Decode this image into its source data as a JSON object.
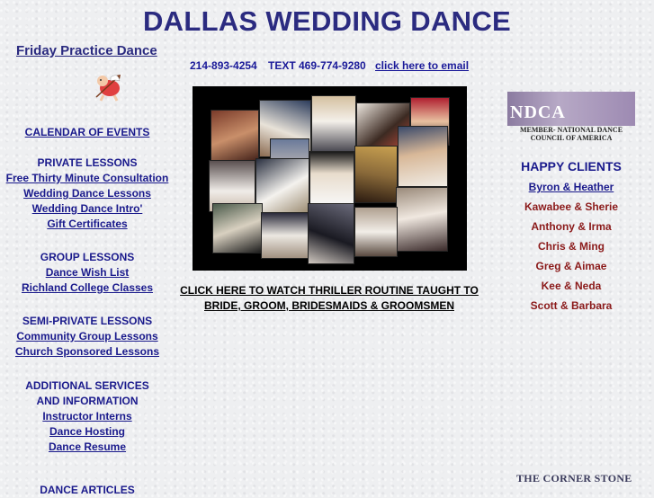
{
  "title": "DALLAS WEDDING DANCE",
  "friday_link": "Friday Practice Dance",
  "contact": {
    "phone": "214-893-4254",
    "text": "TEXT 469-774-9280",
    "email_link": "click here to email"
  },
  "left_menu": [
    {
      "id": "calendar",
      "label": "CALENDAR OF EVENTS ",
      "type": "link"
    },
    {
      "id": "private-header",
      "label": "PRIVATE LESSONS",
      "type": "header"
    },
    {
      "id": "free-consult",
      "label": "Free Thirty Minute Consultation",
      "type": "link"
    },
    {
      "id": "wedding-lessons",
      "label": "Wedding Dance Lessons",
      "type": "link"
    },
    {
      "id": "wedding-intro",
      "label": "Wedding Dance Intro'",
      "type": "link"
    },
    {
      "id": "gift-cert",
      "label": "Gift Certificates",
      "type": "link"
    },
    {
      "id": "group-header",
      "label": "GROUP LESSONS",
      "type": "header"
    },
    {
      "id": "wish-list",
      "label": "Dance Wish List",
      "type": "link"
    },
    {
      "id": "richland",
      "label": "Richland College Classes",
      "type": "link"
    },
    {
      "id": "semi-header",
      "label": "SEMI-PRIVATE LESSONS",
      "type": "header"
    },
    {
      "id": "community",
      "label": "Community Group Lessons",
      "type": "link"
    },
    {
      "id": "church",
      "label": "Church Sponsored Lessons",
      "type": "link"
    },
    {
      "id": "additional-header",
      "label": "ADDITIONAL SERVICES",
      "type": "header"
    },
    {
      "id": "info-header",
      "label": "AND INFORMATION",
      "type": "header"
    },
    {
      "id": "interns",
      "label": "Instructor Interns",
      "type": "link"
    },
    {
      "id": "hosting",
      "label": "Dance Hosting",
      "type": "link"
    },
    {
      "id": "resume",
      "label": "Dance Resume",
      "type": "link"
    },
    {
      "id": "articles-header",
      "label": "DANCE ARTICLES",
      "type": "header"
    }
  ],
  "thriller_link": "CLICK HERE TO WATCH THRILLER ROUTINE TAUGHT TO BRIDE, GROOM, BRIDESMAIDS & GROOMSMEN",
  "ndca": {
    "logo_text": "NDCA",
    "member_text": "MEMBER- NATIONAL DANCE COUNCIL OF AMERICA"
  },
  "happy_clients_title": "HAPPY CLIENTS",
  "clients": [
    "Byron & Heather",
    "Kawabee & Sherie",
    "Anthony & Irma",
    "Chris & Ming",
    "Greg & Aimae",
    "Kee & Neda",
    "Scott & Barbara"
  ],
  "corner_stone": "THE CORNER STONE",
  "colors": {
    "title": "#2b2b80",
    "link": "#1a1a8c",
    "client": "#8b1a1a"
  }
}
